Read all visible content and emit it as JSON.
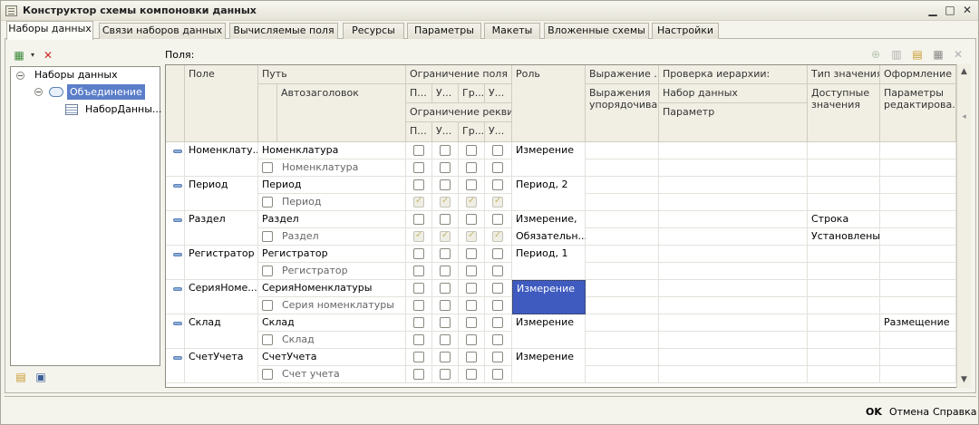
{
  "window": {
    "title": "Конструктор схемы компоновки данных"
  },
  "tabs": [
    "Наборы данных",
    "Связи наборов данных",
    "Вычисляемые поля",
    "Ресурсы",
    "Параметры",
    "Макеты",
    "Вложенные схемы",
    "Настройки"
  ],
  "tree": {
    "root": "Наборы данных",
    "child": "Объединение",
    "leaf": "НаборДанны..."
  },
  "fields_label": "Поля:",
  "headers": {
    "field": "Поле",
    "path": "Путь",
    "autotitle": "Автозаголовок",
    "field_restriction": "Ограничение поля",
    "req_restriction": "Ограничение рекви...",
    "p": "П...",
    "u": "У...",
    "g": "Гр...",
    "u2": "У...",
    "role": "Роль",
    "expr": "Выражение ...",
    "expr_order": "Выражения упорядочива...",
    "hier_check": "Проверка иерархии:",
    "dataset": "Набор данных",
    "param": "Параметр",
    "value_type": "Тип значения",
    "avail_values": "Доступные значения",
    "design": "Оформление",
    "edit_params": "Параметры редактирова..."
  },
  "rows": [
    {
      "field": "Номенклату...",
      "path": "Номенклатура",
      "title": "Номенклатура",
      "role": "Измерение",
      "role2": "",
      "vtype": "",
      "vtype2": "",
      "design": "",
      "checked": false,
      "selected": false
    },
    {
      "field": "Период",
      "path": "Период",
      "title": "Период",
      "role": "Период, 2",
      "role2": "",
      "vtype": "",
      "vtype2": "",
      "design": "",
      "checked": true,
      "selected": false
    },
    {
      "field": "Раздел",
      "path": "Раздел",
      "title": "Раздел",
      "role": "Измерение,",
      "role2": "Обязательн...",
      "vtype": "Строка",
      "vtype2": "Установлены",
      "design": "",
      "checked": true,
      "selected": false
    },
    {
      "field": "Регистратор",
      "path": "Регистратор",
      "title": "Регистратор",
      "role": "Период, 1",
      "role2": "",
      "vtype": "",
      "vtype2": "",
      "design": "",
      "checked": false,
      "selected": false
    },
    {
      "field": "СерияНоме...",
      "path": "СерияНоменклатуры",
      "title": "Серия номенклатуры",
      "role": "Измерение",
      "role2": "",
      "vtype": "",
      "vtype2": "",
      "design": "",
      "checked": false,
      "selected": true
    },
    {
      "field": "Склад",
      "path": "Склад",
      "title": "Склад",
      "role": "Измерение",
      "role2": "",
      "vtype": "",
      "vtype2": "",
      "design": "Размещение",
      "checked": false,
      "selected": false
    },
    {
      "field": "СчетУчета",
      "path": "СчетУчета",
      "title": "Счет учета",
      "role": "Измерение",
      "role2": "",
      "vtype": "",
      "vtype2": "",
      "design": "",
      "checked": false,
      "selected": false
    }
  ],
  "footer": {
    "ok": "OK",
    "cancel": "Отмена",
    "help": "Справка"
  },
  "colors": {
    "selection": "#3f5bbf",
    "header_bg": "#f1efe4",
    "panel_bg": "#f4f3ec"
  }
}
